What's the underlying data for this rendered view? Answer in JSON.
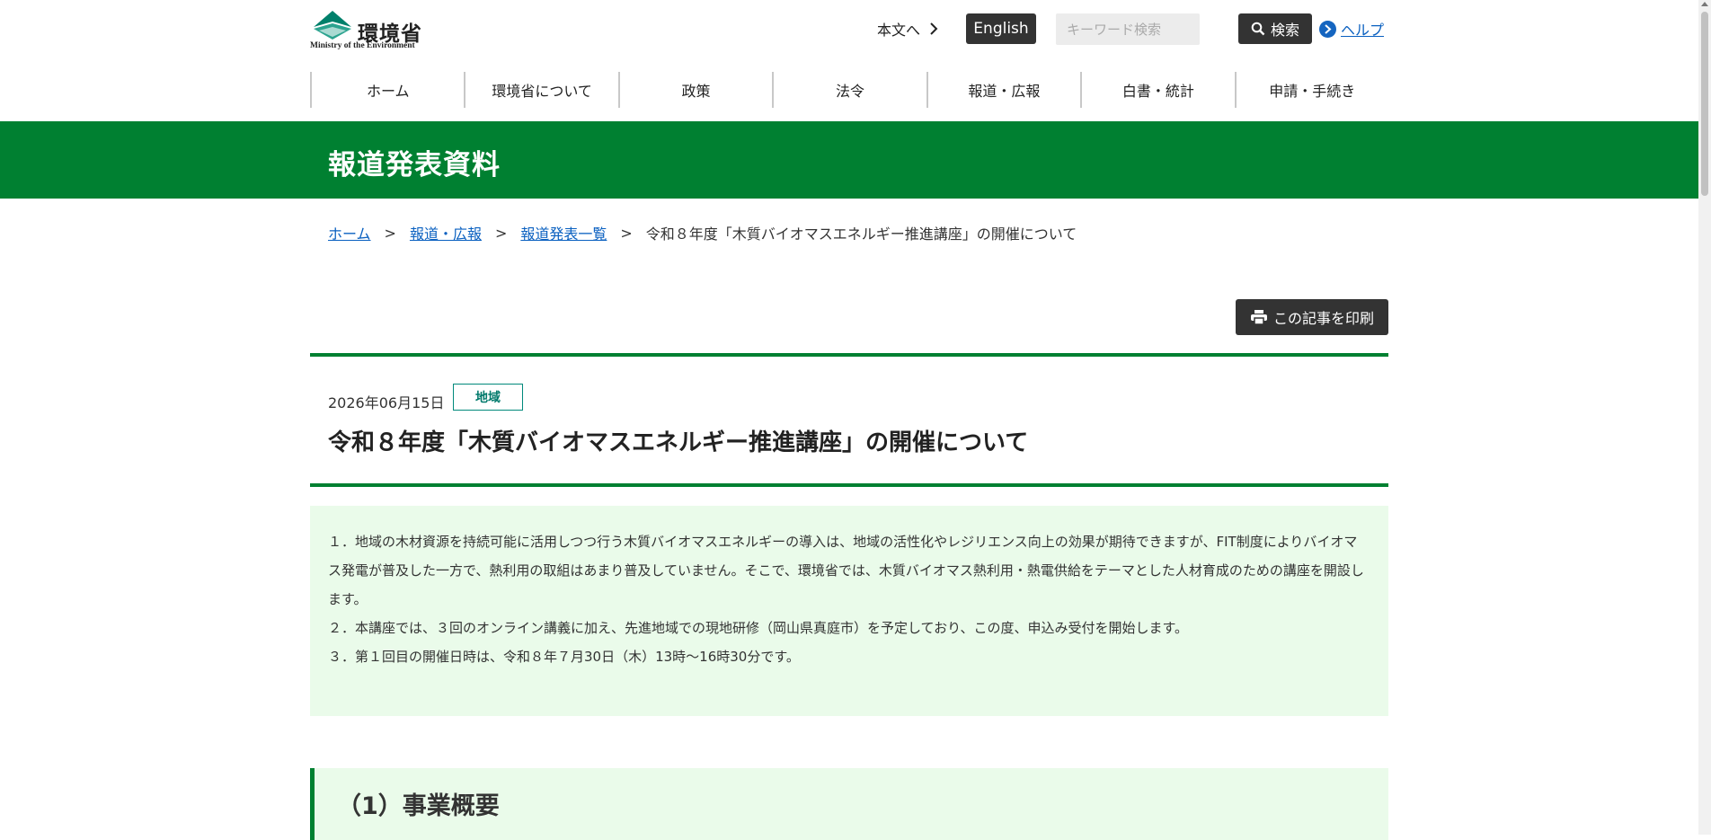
{
  "header": {
    "logo_jp": "環境省",
    "logo_en": "Ministry of the Environment",
    "skip_link": "本文へ",
    "english": "English",
    "search_placeholder": "キーワード検索",
    "search_button": "検索",
    "help": "ヘルプ"
  },
  "nav": {
    "items": [
      "ホーム",
      "環境省について",
      "政策",
      "法令",
      "報道・広報",
      "白書・統計",
      "申請・手続き"
    ]
  },
  "banner": {
    "title": "報道発表資料"
  },
  "breadcrumb": {
    "items": [
      "ホーム",
      "報道・広報",
      "報道発表一覧"
    ],
    "current": "令和８年度「木質バイオマスエネルギー推進講座」の開催について",
    "separator": ">"
  },
  "print_button": "この記事を印刷",
  "article": {
    "date": "2026年06月15日",
    "tag": "地域",
    "title": "令和８年度「木質バイオマスエネルギー推進講座」の開催について",
    "summary": [
      "１．地域の木材資源を持続可能に活用しつつ行う木質バイオマスエネルギーの導入は、地域の活性化やレジリエンス向上の効果が期待できますが、FIT制度によりバイオマス発電が普及した一方で、熱利用の取組はあまり普及していません。そこで、環境省では、木質バイオマス熱利用・熱電供給をテーマとした人材育成のための講座を開設します。",
      "２．本講座では、３回のオンライン講義に加え、先進地域での現地研修（岡山県真庭市）を予定しており、この度、申込み受付を開始します。",
      "３．第１回目の開催日時は、令和８年７月30日（木）13時～16時30分です。"
    ],
    "section_heading": "（1）事業概要"
  },
  "colors": {
    "brand_green": "#008031",
    "summary_bg": "#eafbea",
    "link_blue": "#0a60c0",
    "button_dark": "#333333"
  }
}
